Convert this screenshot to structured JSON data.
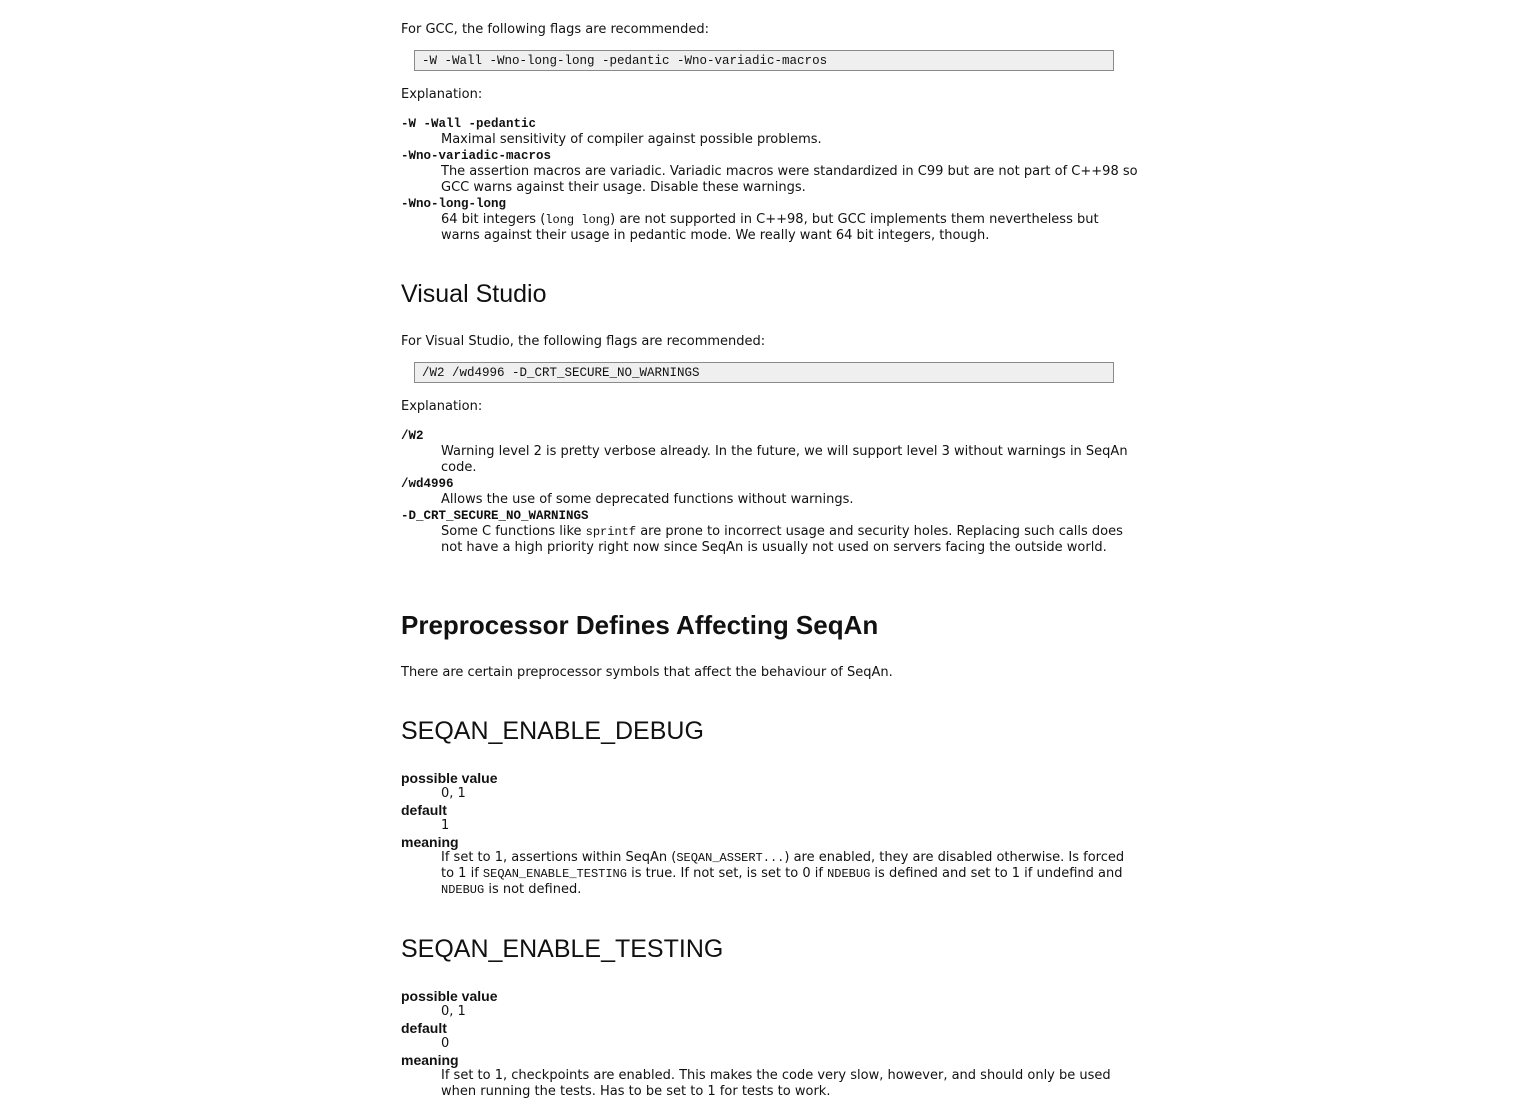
{
  "gcc": {
    "intro": "For GCC, the following flags are recommended:",
    "code": "-W -Wall -Wno-long-long -pedantic -Wno-variadic-macros",
    "explanation_label": "Explanation:",
    "items": [
      {
        "term": "-W -Wall -pedantic",
        "desc": "Maximal sensitivity of compiler against possible problems."
      },
      {
        "term": "-Wno-variadic-macros",
        "desc": "The assertion macros are variadic. Variadic macros were standardized in C99 but are not part of C++98 so GCC warns against their usage. Disable these warnings."
      },
      {
        "term": "-Wno-long-long",
        "desc_pre": "64 bit integers (",
        "desc_code": "long long",
        "desc_post": ") are not supported in C++98, but GCC implements them nevertheless but warns against their usage in pedantic mode. We really want 64 bit integers, though."
      }
    ]
  },
  "vs": {
    "heading": "Visual Studio",
    "intro": "For Visual Studio, the following flags are recommended:",
    "code": "/W2 /wd4996 -D_CRT_SECURE_NO_WARNINGS",
    "explanation_label": "Explanation:",
    "items": [
      {
        "term": "/W2",
        "desc": "Warning level 2 is pretty verbose already. In the future, we will support level 3 without warnings in SeqAn code."
      },
      {
        "term": "/wd4996",
        "desc": "Allows the use of some deprecated functions without warnings."
      },
      {
        "term": "-D_CRT_SECURE_NO_WARNINGS",
        "desc_pre": "Some C functions like ",
        "desc_code": "sprintf",
        "desc_post": " are prone to incorrect usage and security holes. Replacing such calls does not have a high priority right now since SeqAn is usually not used on servers facing the outside world."
      }
    ]
  },
  "preproc": {
    "heading": "Preprocessor Defines Affecting SeqAn",
    "intro": "There are certain preprocessor symbols that affect the behaviour of SeqAn."
  },
  "debug": {
    "heading": "SEQAN_ENABLE_DEBUG",
    "possible_label": "possible value",
    "possible_value": "0, 1",
    "default_label": "default",
    "default_value": "1",
    "meaning_label": "meaning",
    "m1": "If set to 1, assertions within SeqAn (",
    "c1": "SEQAN_ASSERT...",
    "m2": ") are enabled, they are disabled otherwise. Is forced to 1 if ",
    "c2": "SEQAN_ENABLE_TESTING",
    "m3": " is true. If not set, is set to 0 if ",
    "c3": "NDEBUG",
    "m4": " is defined and set to 1 if undefind and ",
    "c4": "NDEBUG",
    "m5": " is not defined."
  },
  "testing": {
    "heading": "SEQAN_ENABLE_TESTING",
    "possible_label": "possible value",
    "possible_value": "0, 1",
    "default_label": "default",
    "default_value": "0",
    "meaning_label": "meaning",
    "meaning": "If set to 1, checkpoints are enabled. This makes the code very slow, however, and should only be used when running the tests. Has to be set to 1 for tests to work."
  }
}
